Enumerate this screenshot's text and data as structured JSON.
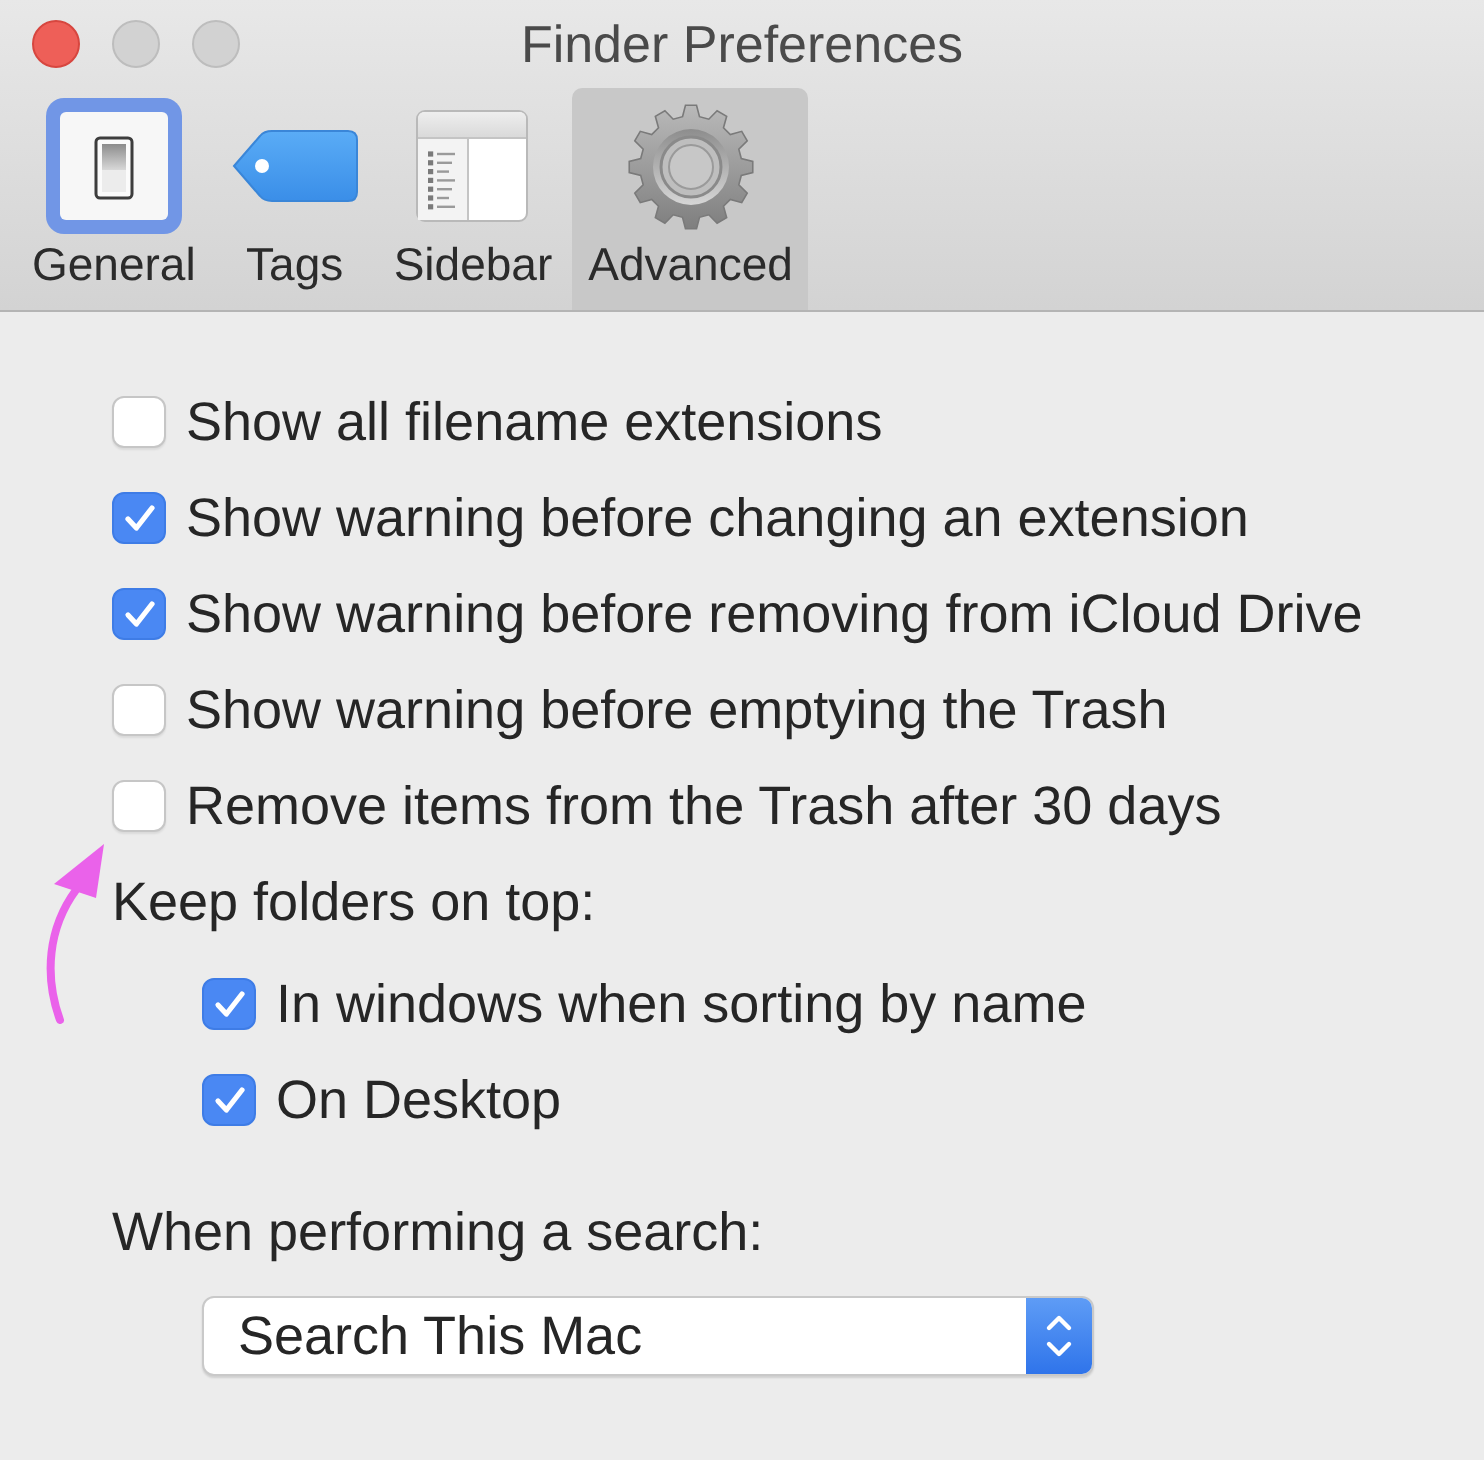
{
  "window": {
    "title": "Finder Preferences",
    "buttons": [
      {
        "kind": "close",
        "disabled": false
      },
      {
        "kind": "minimize",
        "disabled": true
      },
      {
        "kind": "zoom",
        "disabled": true
      }
    ]
  },
  "tabs": [
    {
      "label": "General",
      "selected": false
    },
    {
      "label": "Tags",
      "selected": false
    },
    {
      "label": "Sidebar",
      "selected": false
    },
    {
      "label": "Advanced",
      "selected": true
    }
  ],
  "options": [
    {
      "label": "Show all filename extensions",
      "checked": false
    },
    {
      "label": "Show warning before changing an extension",
      "checked": true
    },
    {
      "label": "Show warning before removing from iCloud Drive",
      "checked": true
    },
    {
      "label": "Show warning before emptying the Trash",
      "checked": false
    },
    {
      "label": "Remove items from the Trash after 30 days",
      "checked": false
    }
  ],
  "keep_folders_on_top": {
    "label": "Keep folders on top:",
    "options": [
      {
        "label": "In windows when sorting by name",
        "checked": true
      },
      {
        "label": "On Desktop",
        "checked": true
      }
    ]
  },
  "search": {
    "label": "When performing a search:",
    "scope_popup": {
      "value": "Search This Mac"
    }
  }
}
